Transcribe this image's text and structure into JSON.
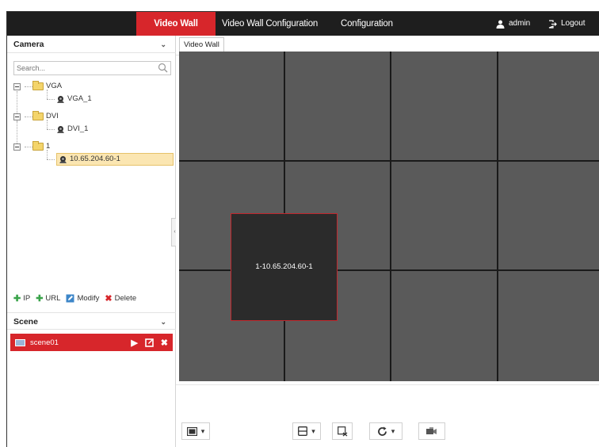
{
  "header": {
    "tabs": [
      {
        "label": "Video Wall",
        "active": true
      },
      {
        "label": "Video Wall Configuration",
        "active": false
      },
      {
        "label": "Configuration",
        "active": false
      }
    ],
    "user_label": "admin",
    "logout_label": "Logout",
    "accent_color": "#d7262b"
  },
  "camera_panel": {
    "title": "Camera",
    "search_placeholder": "Search...",
    "tree": [
      {
        "type": "group",
        "label": "VGA",
        "children": [
          {
            "type": "camera",
            "label": "VGA_1"
          }
        ]
      },
      {
        "type": "group",
        "label": "DVI",
        "children": [
          {
            "type": "camera",
            "label": "DVI_1"
          }
        ]
      },
      {
        "type": "group",
        "label": "1",
        "children": [
          {
            "type": "camera",
            "label": "10.65.204.60-1",
            "selected": true
          }
        ]
      }
    ],
    "tools": {
      "ip_label": "IP",
      "url_label": "URL",
      "modify_label": "Modify",
      "delete_label": "Delete"
    }
  },
  "scene_panel": {
    "title": "Scene",
    "scenes": [
      {
        "label": "scene01",
        "selected": true
      }
    ]
  },
  "video_wall": {
    "tab_label": "Video Wall",
    "grid_rows": 3,
    "grid_cols": 4,
    "windows": [
      {
        "label": "1-10.65.204.60-1"
      }
    ]
  }
}
